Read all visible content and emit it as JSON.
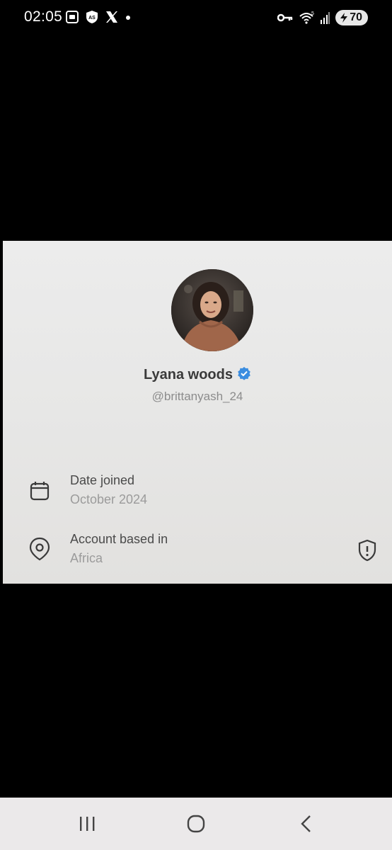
{
  "status_bar": {
    "time": "02:05",
    "left_icons": [
      "screenshot-icon",
      "as-app-icon",
      "x-logo-icon",
      "notification-dot-icon"
    ],
    "right_icons": [
      "vpn-key-icon",
      "wifi-icon",
      "signal-icon",
      "battery-icon"
    ],
    "battery_level": "70"
  },
  "profile": {
    "display_name": "Lyana woods",
    "verified": true,
    "handle": "@brittanyash_24"
  },
  "details": [
    {
      "icon": "calendar-icon",
      "title": "Date joined",
      "value": "October 2024"
    },
    {
      "icon": "location-pin-icon",
      "title": "Account based in",
      "value": "Africa"
    }
  ],
  "colors": {
    "verified_badge": "#3b8de0",
    "background": "#000000",
    "card": "#e8e8e7",
    "nav_bar": "#ebe9ea"
  },
  "nav": [
    "recent-apps-button",
    "home-button",
    "back-button"
  ]
}
